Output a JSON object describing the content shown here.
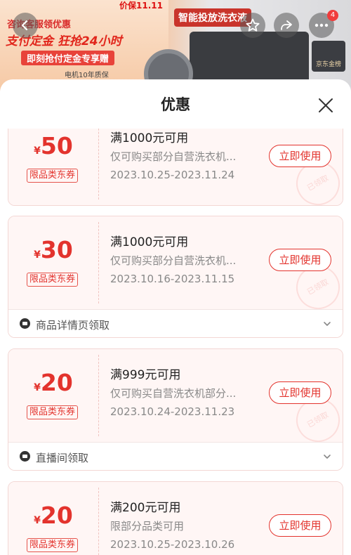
{
  "background": {
    "promo_line1": "咨询客服领优惠",
    "promo_line2": "支付定金 狂抢24小时",
    "promo_line3": "即刻抢付定金专享赠",
    "promo_line4": "电机10年质保",
    "price_tag": "价保11.11",
    "ad_title": "智能投放洗衣液",
    "badge_text": "京东金榜",
    "cart_count": "4"
  },
  "sheet": {
    "title": "优惠"
  },
  "coupons": [
    {
      "currency": "¥",
      "amount": "50",
      "tag": "限品类东券",
      "condition": "满1000元可用",
      "description": "仅可购买部分自营洗衣机...",
      "date_range": "2023.10.25-2023.11.24",
      "button": "立即使用",
      "stamp": "已领取",
      "source": ""
    },
    {
      "currency": "¥",
      "amount": "30",
      "tag": "限品类东券",
      "condition": "满1000元可用",
      "description": "仅可购买部分自营洗衣机...",
      "date_range": "2023.10.16-2023.11.15",
      "button": "立即使用",
      "stamp": "已领取",
      "source": "商品详情页领取"
    },
    {
      "currency": "¥",
      "amount": "20",
      "tag": "限品类东券",
      "condition": "满999元可用",
      "description": "仅可购买自营洗衣机部分...",
      "date_range": "2023.10.24-2023.11.23",
      "button": "立即使用",
      "stamp": "已领取",
      "source": "直播间领取"
    },
    {
      "currency": "¥",
      "amount": "20",
      "tag": "限品类东券",
      "condition": "满200元可用",
      "description": "限部分品类可用",
      "date_range": "2023.10.25-2023.10.26",
      "button": "立即使用",
      "stamp": "",
      "source": ""
    }
  ],
  "colors": {
    "accent": "#e3332d",
    "coupon_bg": "#fff6f5"
  }
}
